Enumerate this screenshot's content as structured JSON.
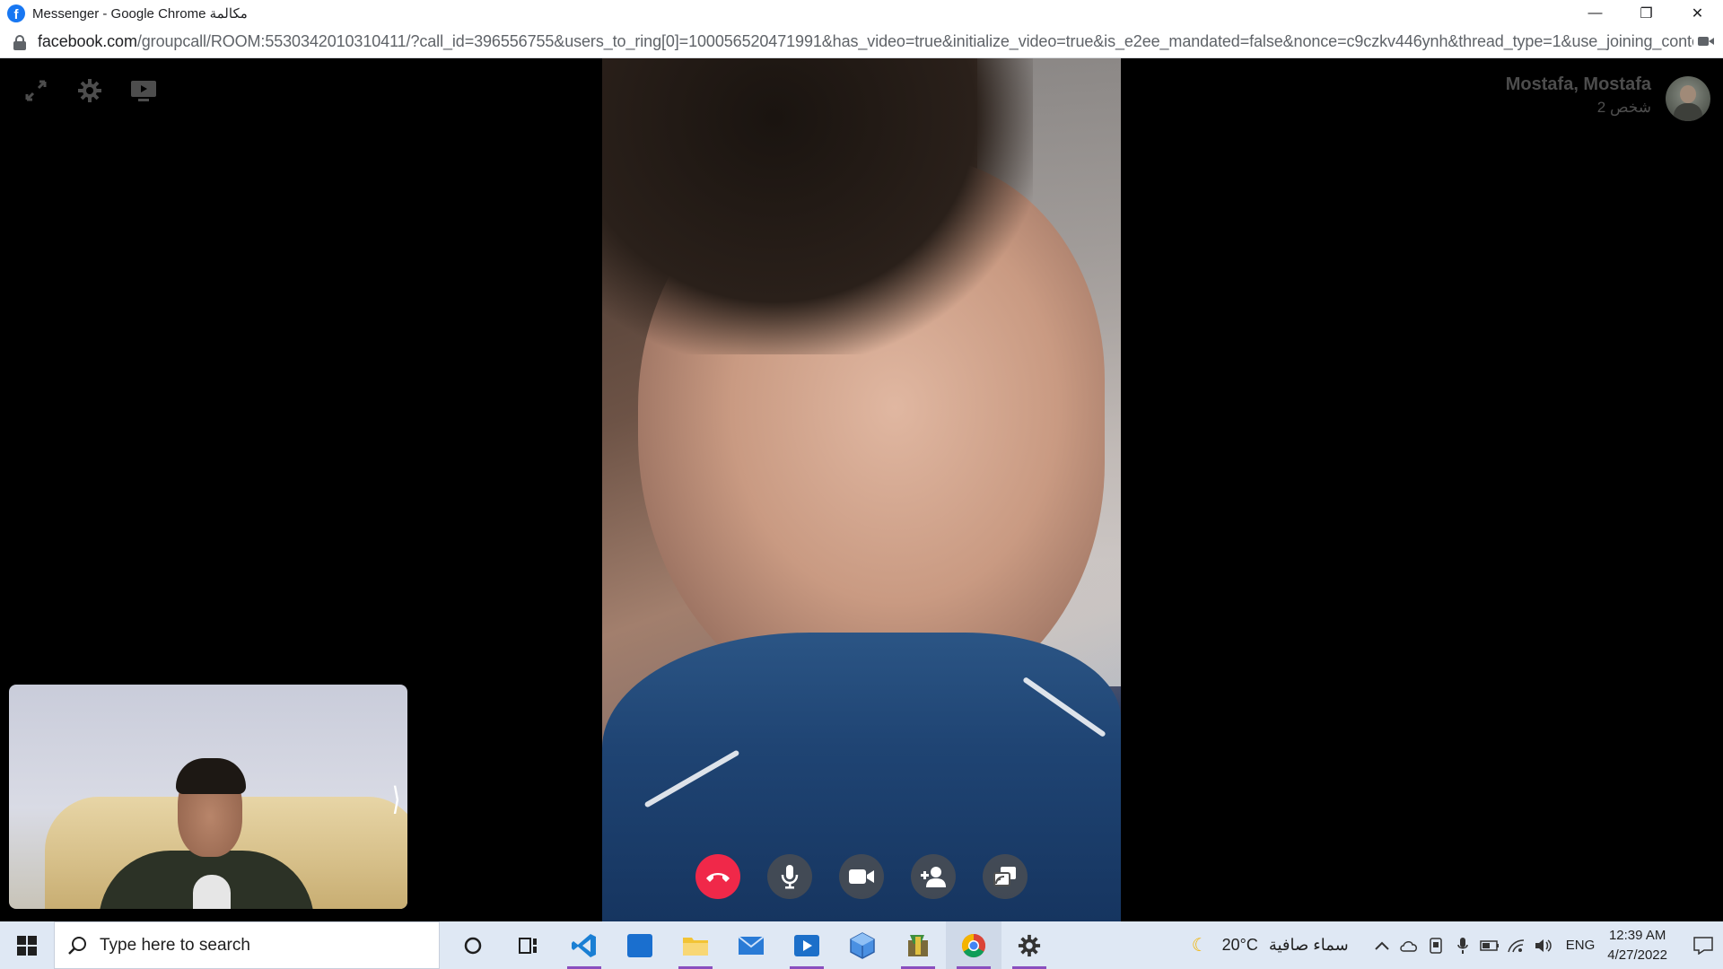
{
  "window": {
    "title": "Messenger - Google Chrome مكالمة",
    "minimize_label": "—",
    "restore_label": "❐",
    "close_label": "✕"
  },
  "browser": {
    "url_domain": "facebook.com",
    "url_path": "/groupcall/ROOM:5530342010310411/?call_id=396556755&users_to_ring[0]=100056520471991&has_video=true&initialize_video=true&is_e2ee_mandated=false&nonce=c9czkv446ynh&thread_type=1&use_joining_conte..."
  },
  "call": {
    "caller_name": "Mostafa, Mostafa",
    "participants": "2 شخص",
    "tools": [
      "expand-icon",
      "gear-icon",
      "screen-share-icon"
    ],
    "controls": [
      "end-call-icon",
      "microphone-icon",
      "video-camera-icon",
      "add-person-icon",
      "switch-view-icon"
    ],
    "self_view_chevron": "⟩",
    "end_call_color": "#f02849"
  },
  "taskbar": {
    "search_placeholder": "Type here to search",
    "apps": [
      "cortana-icon",
      "task-view-icon",
      "vscode-icon",
      "store-icon",
      "file-explorer-icon",
      "mail-icon",
      "media-player-icon",
      "3d-box-icon",
      "app-icon",
      "chrome-icon",
      "settings-icon"
    ],
    "weather_temp": "20°C",
    "weather_desc": "سماء صافية",
    "language": "ENG",
    "time": "12:39 AM",
    "date": "4/27/2022"
  }
}
